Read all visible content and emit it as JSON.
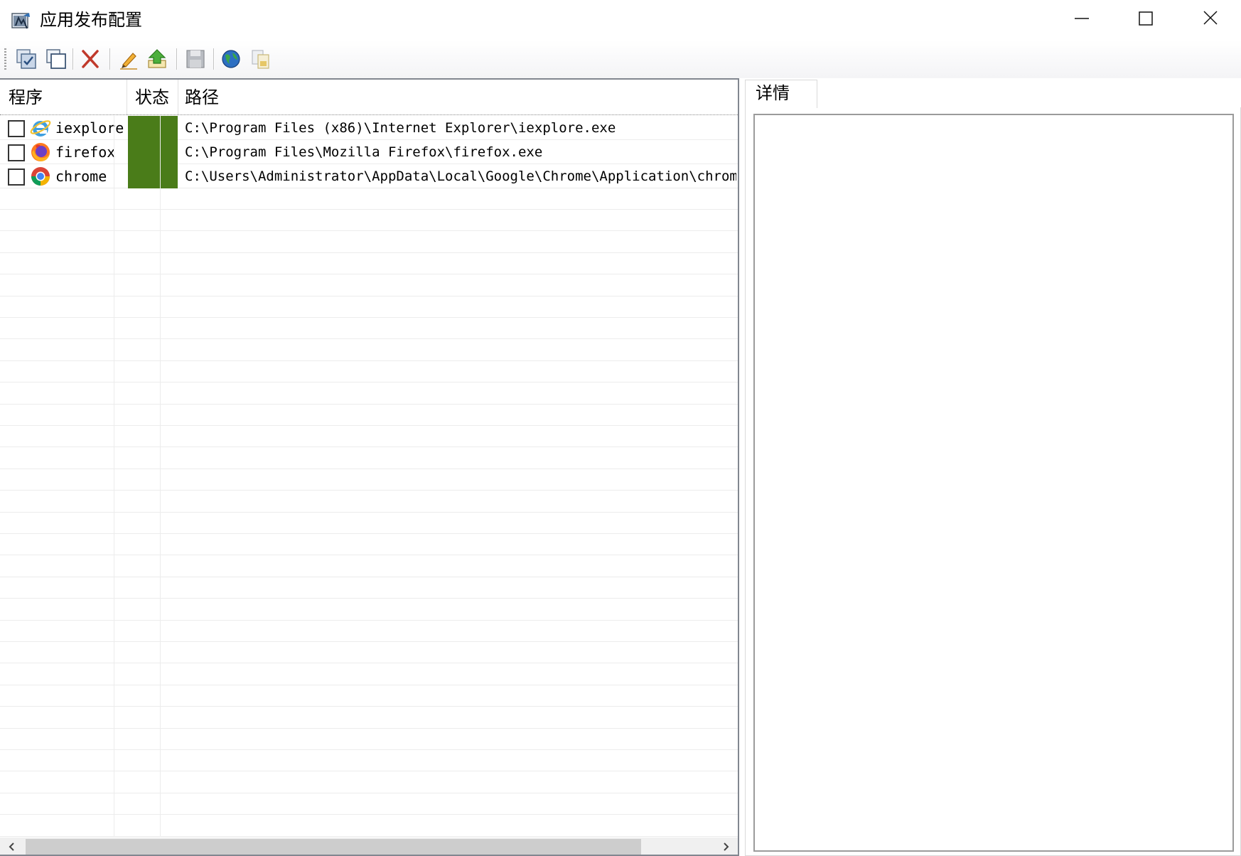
{
  "window": {
    "title": "应用发布配置",
    "controls": {
      "minimize": "minimize",
      "maximize": "maximize",
      "close": "close"
    }
  },
  "toolbar": {
    "buttons": [
      {
        "icon": "select-all-icon"
      },
      {
        "icon": "deselect-all-icon"
      },
      {
        "icon": "delete-icon"
      },
      {
        "icon": "edit-icon"
      },
      {
        "icon": "publish-icon"
      },
      {
        "icon": "save-icon"
      },
      {
        "icon": "globe-icon"
      },
      {
        "icon": "copy-icon"
      }
    ]
  },
  "list": {
    "columns": [
      "程序",
      "状态",
      "路径"
    ],
    "rows": [
      {
        "program": "iexplore",
        "icon": "internet-explorer-icon",
        "status_color": "#4a7c19",
        "path": "C:\\Program Files (x86)\\Internet Explorer\\iexplore.exe",
        "checked": false
      },
      {
        "program": "firefox",
        "icon": "firefox-icon",
        "status_color": "#4a7c19",
        "path": "C:\\Program Files\\Mozilla Firefox\\firefox.exe",
        "checked": false
      },
      {
        "program": "chrome",
        "icon": "chrome-icon",
        "status_color": "#4a7c19",
        "path": "C:\\Users\\Administrator\\AppData\\Local\\Google\\Chrome\\Application\\chrome.exe",
        "checked": false
      }
    ]
  },
  "detail": {
    "tab_label": "详情"
  }
}
